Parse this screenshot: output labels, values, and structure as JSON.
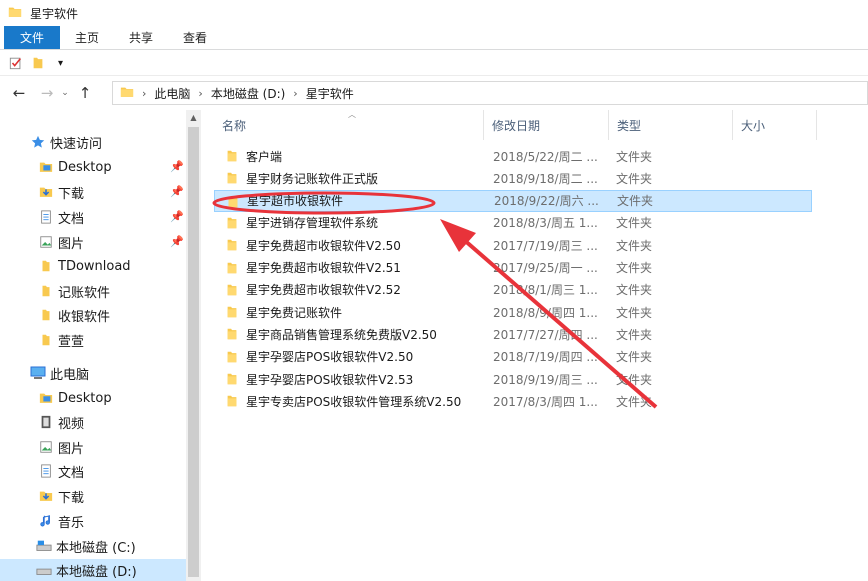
{
  "window": {
    "title": "星宇软件"
  },
  "ribbon": {
    "tabs": [
      "文件",
      "主页",
      "共享",
      "查看"
    ]
  },
  "qat": {
    "dropdown_glyph": "▾"
  },
  "address": {
    "back": "←",
    "forward": "→",
    "history": "⌄",
    "up": "↑",
    "crumbs": [
      "此电脑",
      "本地磁盘 (D:)",
      "星宇软件"
    ]
  },
  "nav": {
    "quick_access": "快速访问",
    "quick_items": [
      "Desktop",
      "下载",
      "文档",
      "图片",
      "TDownload",
      "记账软件",
      "收银软件",
      "萱萱"
    ],
    "this_pc": "此电脑",
    "pc_items": [
      "Desktop",
      "视频",
      "图片",
      "文档",
      "下载",
      "音乐",
      "本地磁盘 (C:)",
      "本地磁盘 (D:)"
    ],
    "scroll_up": "▲"
  },
  "columns": {
    "name": "名称",
    "date": "修改日期",
    "type": "类型",
    "size": "大小",
    "sort_glyph": "︿"
  },
  "files": [
    {
      "name": "客户端",
      "date": "2018/5/22/周二 ...",
      "type": "文件夹"
    },
    {
      "name": "星宇财务记账软件正式版",
      "date": "2018/9/18/周二 ...",
      "type": "文件夹"
    },
    {
      "name": "星宇超市收银软件",
      "date": "2018/9/22/周六 ...",
      "type": "文件夹"
    },
    {
      "name": "星宇进销存管理软件系统",
      "date": "2018/8/3/周五 1...",
      "type": "文件夹"
    },
    {
      "name": "星宇免费超市收银软件V2.50",
      "date": "2017/7/19/周三 ...",
      "type": "文件夹"
    },
    {
      "name": "星宇免费超市收银软件V2.51",
      "date": "2017/9/25/周一 ...",
      "type": "文件夹"
    },
    {
      "name": "星宇免费超市收银软件V2.52",
      "date": "2018/8/1/周三 1...",
      "type": "文件夹"
    },
    {
      "name": "星宇免费记账软件",
      "date": "2018/8/9/周四 1...",
      "type": "文件夹"
    },
    {
      "name": "星宇商品销售管理系统免费版V2.50",
      "date": "2017/7/27/周四 ...",
      "type": "文件夹"
    },
    {
      "name": "星宇孕婴店POS收银软件V2.50",
      "date": "2018/7/19/周四 ...",
      "type": "文件夹"
    },
    {
      "name": "星宇孕婴店POS收银软件V2.53",
      "date": "2018/9/19/周三 ...",
      "type": "文件夹"
    },
    {
      "name": "星宇专卖店POS收银软件管理系统V2.50",
      "date": "2017/8/3/周四 1...",
      "type": "文件夹"
    }
  ],
  "colors": {
    "accent": "#1979ca",
    "selection": "#cce8ff",
    "annotation": "#e8333a",
    "folder": "#f8c94f"
  }
}
